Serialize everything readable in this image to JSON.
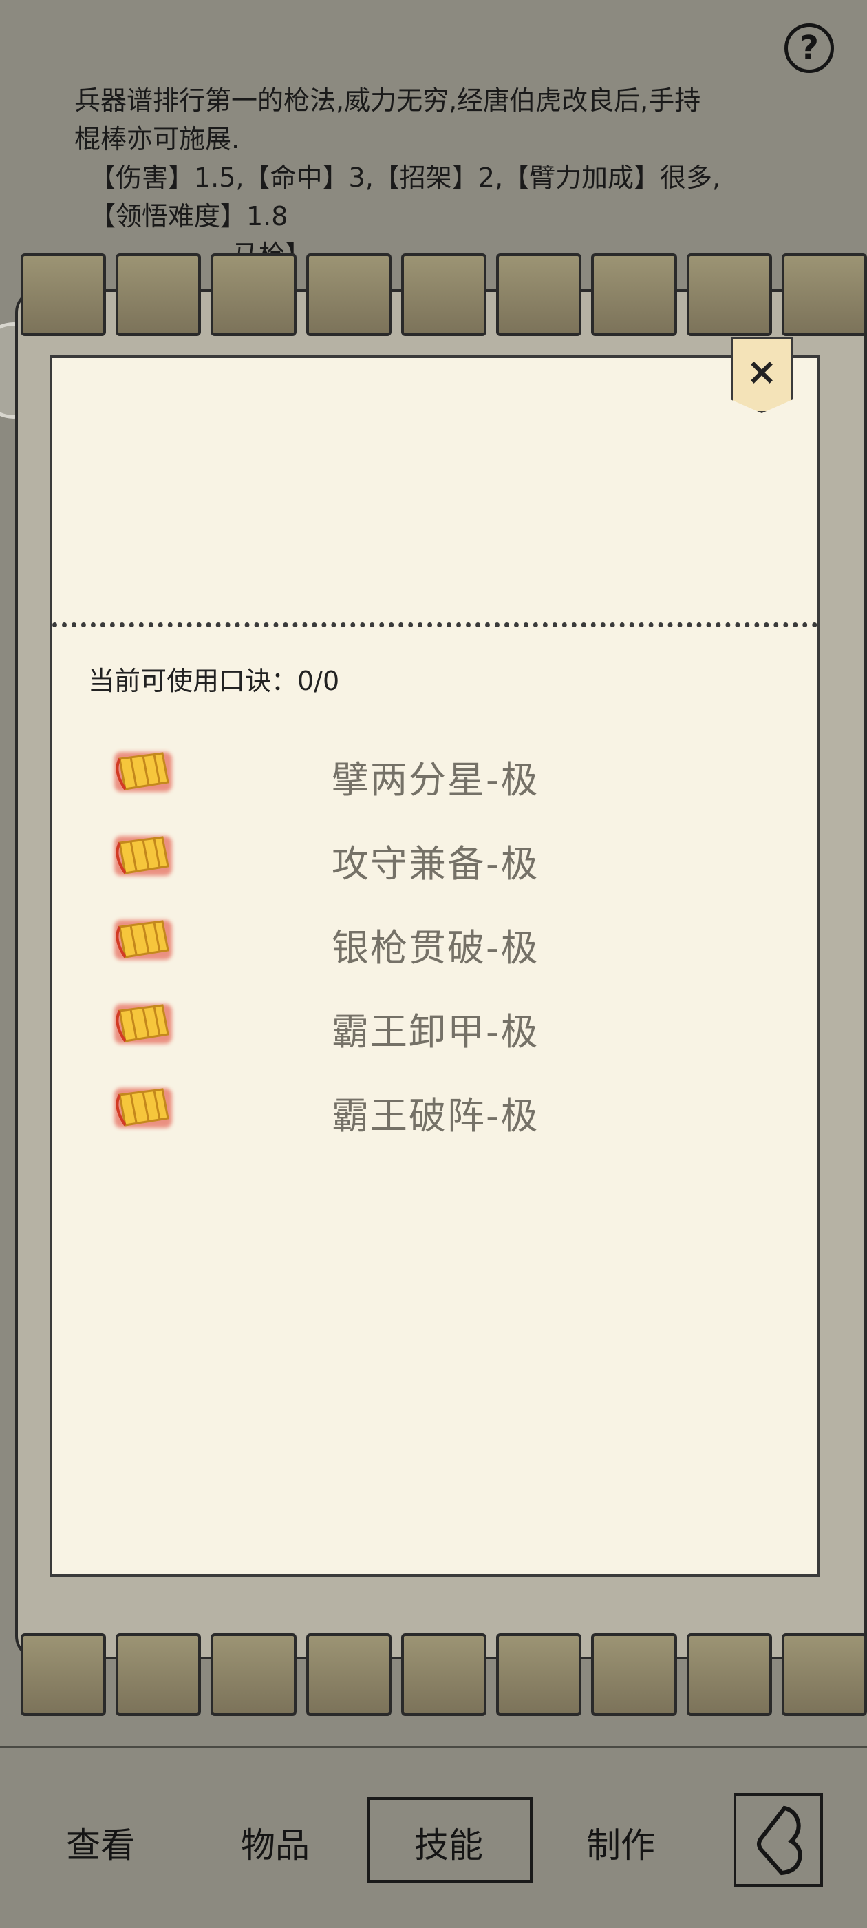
{
  "description": {
    "line1": "兵器谱排行第一的枪法,威力无穷,经唐伯虎改良后,手持",
    "line2": "棍棒亦可施展.",
    "line3": "【伤害】1.5,【命中】3,【招架】2,【臂力加成】很多,",
    "line4": "【领悟难度】1.8",
    "line5": "马枪】"
  },
  "help": {
    "label": "?"
  },
  "panel": {
    "close_label": "×",
    "available_label": "当前可使用口诀：0/0",
    "skills": [
      {
        "name": "擘两分星-极"
      },
      {
        "name": "攻守兼备-极"
      },
      {
        "name": "银枪贯破-极"
      },
      {
        "name": "霸王卸甲-极"
      },
      {
        "name": "霸王破阵-极"
      }
    ]
  },
  "nav": {
    "items": [
      {
        "label": "查看"
      },
      {
        "label": "物品"
      },
      {
        "label": "技能"
      },
      {
        "label": "制作"
      }
    ],
    "active": "技能"
  },
  "colors": {
    "panel_bg": "#f8f3e4",
    "overlay": "#8c8a80",
    "scroll_icon": "#f0c040",
    "scroll_glow": "#e04030",
    "skill_text": "#757167"
  }
}
